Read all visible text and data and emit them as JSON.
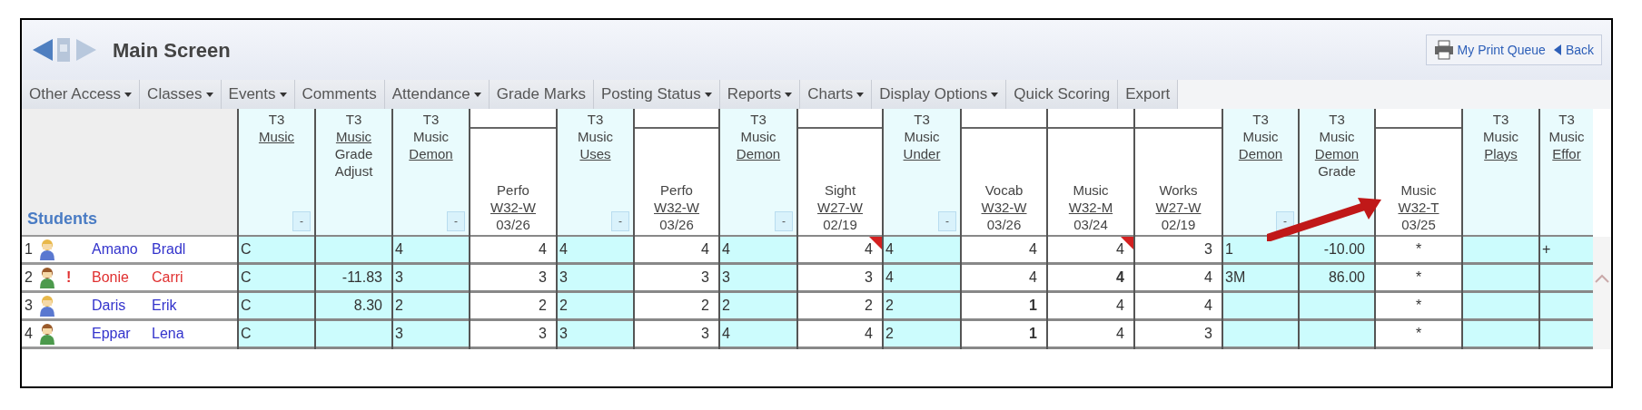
{
  "window": {
    "title": "Main Screen"
  },
  "toolbar_buttons": [
    {
      "label": "My Print Queue",
      "kind": "print"
    },
    {
      "label": "Back",
      "kind": "back"
    }
  ],
  "menu": [
    {
      "label": "Other Access",
      "has_menu": true
    },
    {
      "label": "Classes",
      "has_menu": true
    },
    {
      "label": "Events",
      "has_menu": true
    },
    {
      "label": "Comments",
      "has_menu": false
    },
    {
      "label": "Attendance",
      "has_menu": true
    },
    {
      "label": "Grade Marks",
      "has_menu": false
    },
    {
      "label": "Posting Status",
      "has_menu": true
    },
    {
      "label": "Reports",
      "has_menu": true
    },
    {
      "label": "Charts",
      "has_menu": true
    },
    {
      "label": "Display Options",
      "has_menu": true
    },
    {
      "label": "Quick Scoring",
      "has_menu": false
    },
    {
      "label": "Export",
      "has_menu": false
    }
  ],
  "table": {
    "students_header": "Students",
    "columns": [
      {
        "kind": "category",
        "lines": [
          {
            "text": "T3",
            "link": false
          },
          {
            "text": "Music",
            "link": true
          }
        ],
        "toggle": "-"
      },
      {
        "kind": "adjust",
        "lines": [
          {
            "text": "T3",
            "link": false
          },
          {
            "text": "Music",
            "link": true
          },
          {
            "text": "Grade",
            "link": false
          },
          {
            "text": "Adjust",
            "link": false
          }
        ]
      },
      {
        "kind": "category",
        "lines": [
          {
            "text": "T3",
            "link": false
          },
          {
            "text": "Music",
            "link": false
          },
          {
            "text": "Demon",
            "link": true
          }
        ],
        "toggle": "-"
      },
      {
        "kind": "assignment",
        "lines": [
          {
            "text": "Perfo",
            "link": false
          },
          {
            "text": "W32-W",
            "link": true
          },
          {
            "text": "03/26",
            "link": false
          }
        ]
      },
      {
        "kind": "category",
        "lines": [
          {
            "text": "T3",
            "link": false
          },
          {
            "text": "Music",
            "link": false
          },
          {
            "text": "Uses",
            "link": true
          }
        ],
        "toggle": "-"
      },
      {
        "kind": "assignment",
        "lines": [
          {
            "text": "Perfo",
            "link": false
          },
          {
            "text": "W32-W",
            "link": true
          },
          {
            "text": "03/26",
            "link": false
          }
        ]
      },
      {
        "kind": "category",
        "lines": [
          {
            "text": "T3",
            "link": false
          },
          {
            "text": "Music",
            "link": false
          },
          {
            "text": "Demon",
            "link": true
          }
        ],
        "toggle": "-"
      },
      {
        "kind": "assignment",
        "lines": [
          {
            "text": "Sight",
            "link": false
          },
          {
            "text": "W27-W",
            "link": true
          },
          {
            "text": "02/19",
            "link": false
          }
        ]
      },
      {
        "kind": "category",
        "lines": [
          {
            "text": "T3",
            "link": false
          },
          {
            "text": "Music",
            "link": false
          },
          {
            "text": "Under",
            "link": true
          }
        ],
        "toggle": "-"
      },
      {
        "kind": "assignment",
        "lines": [
          {
            "text": "Vocab",
            "link": false
          },
          {
            "text": "W32-W",
            "link": true
          },
          {
            "text": "03/26",
            "link": false
          }
        ]
      },
      {
        "kind": "assignment",
        "lines": [
          {
            "text": "Music",
            "link": false
          },
          {
            "text": "W32-M",
            "link": true
          },
          {
            "text": "03/24",
            "link": false
          }
        ]
      },
      {
        "kind": "assignment",
        "lines": [
          {
            "text": "Works",
            "link": false
          },
          {
            "text": "W27-W",
            "link": true
          },
          {
            "text": "02/19",
            "link": false
          }
        ]
      },
      {
        "kind": "category",
        "lines": [
          {
            "text": "T3",
            "link": false
          },
          {
            "text": "Music",
            "link": false
          },
          {
            "text": "Demon",
            "link": true
          }
        ],
        "toggle": "-"
      },
      {
        "kind": "adjust",
        "lines": [
          {
            "text": "T3",
            "link": false
          },
          {
            "text": "Music",
            "link": false
          },
          {
            "text": "Demon",
            "link": true
          },
          {
            "text": "Grade",
            "link": false
          }
        ]
      },
      {
        "kind": "mark",
        "lines": [
          {
            "text": "Music",
            "link": false
          },
          {
            "text": "W32-T",
            "link": true
          },
          {
            "text": "03/25",
            "link": false
          }
        ]
      },
      {
        "kind": "category",
        "lines": [
          {
            "text": "T3",
            "link": false
          },
          {
            "text": "Music",
            "link": false
          },
          {
            "text": "Plays",
            "link": true
          }
        ]
      },
      {
        "kind": "category",
        "lines": [
          {
            "text": "T3",
            "link": false
          },
          {
            "text": "Music",
            "link": false
          },
          {
            "text": "Effor",
            "link": true
          }
        ]
      }
    ],
    "rows": [
      {
        "number": "1",
        "kind": "blue",
        "first": "Amano",
        "last": "Bradl",
        "color": "#3333cc",
        "cells": [
          "C",
          "",
          "4",
          "4",
          "4",
          "4",
          "4",
          {
            "text": "4",
            "flagged": true
          },
          "4",
          "4",
          {
            "text": "4",
            "flagged": true
          },
          "3",
          "1",
          "-10.00",
          "*",
          "",
          "+"
        ]
      },
      {
        "number": "2",
        "kind": "green",
        "alert": "!",
        "first": "Bonie",
        "last": "Carri",
        "color": "#e03030",
        "cells": [
          "C",
          "-11.83",
          "3",
          "3",
          "3",
          "3",
          "3",
          "3",
          "4",
          "4",
          {
            "text": "4",
            "bold": true
          },
          "4",
          "3M",
          "86.00",
          "*",
          "",
          ""
        ]
      },
      {
        "number": "3",
        "kind": "blue",
        "first": "Daris",
        "last": "Erik",
        "color": "#3333cc",
        "cells": [
          "C",
          "8.30",
          "2",
          "2",
          "2",
          "2",
          "2",
          "2",
          "2",
          {
            "text": "1",
            "bold": true
          },
          "4",
          "4",
          "",
          "",
          "*",
          "",
          ""
        ]
      },
      {
        "number": "4",
        "kind": "green",
        "first": "Eppar",
        "last": "Lena",
        "color": "#3333cc",
        "cells": [
          "C",
          "",
          "3",
          "3",
          "3",
          "3",
          "4",
          "4",
          "2",
          {
            "text": "1",
            "bold": true
          },
          "4",
          "3",
          "",
          "",
          "*",
          "",
          ""
        ]
      }
    ]
  }
}
